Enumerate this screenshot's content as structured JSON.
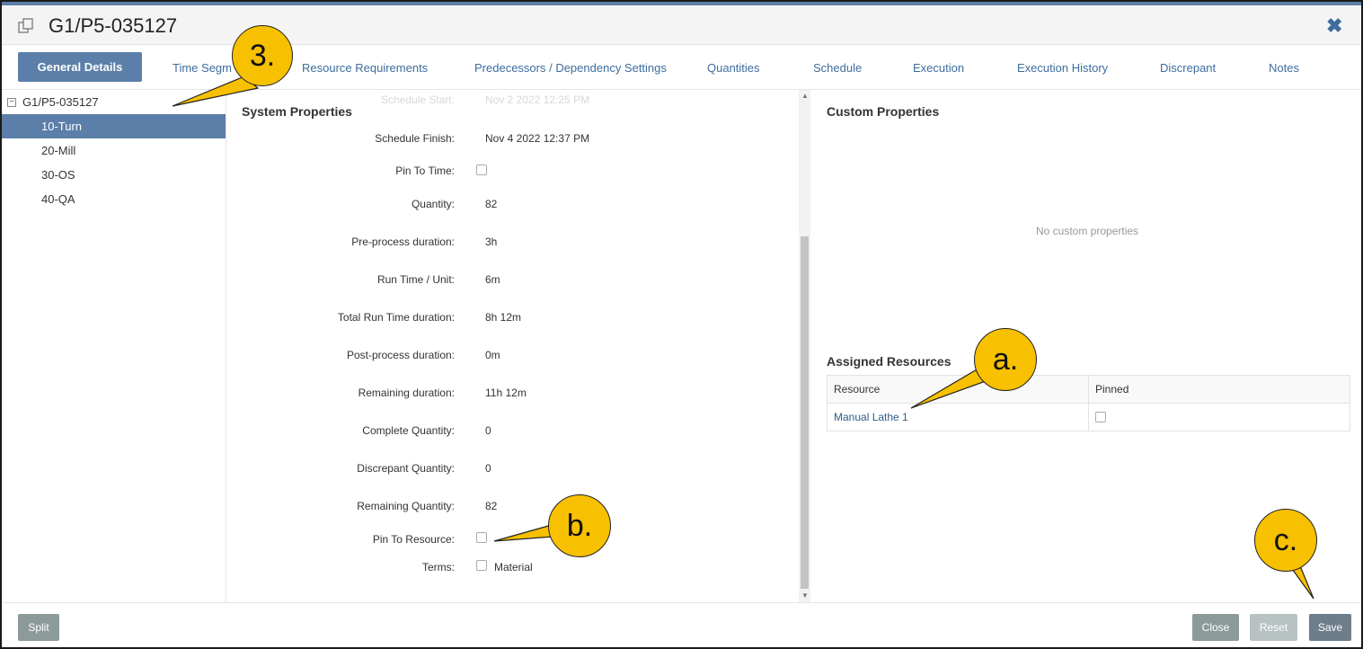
{
  "colors": {
    "accent": "#5b7fa8",
    "selected_row": "#5b7fa8",
    "link": "#3d6d9e",
    "button_gray": "#8c9a9a",
    "button_disabled": "#b9c2c2",
    "button_save": "#6e7d8a",
    "callout": "#f7c000"
  },
  "window": {
    "title": "G1/P5-035127",
    "title_icon": "copy-icon",
    "close_icon": "close-icon"
  },
  "tabs": [
    {
      "label": "General Details",
      "active": true
    },
    {
      "label": "Time Segm"
    },
    {
      "label": "Resource Requirements"
    },
    {
      "label": "Predecessors / Dependency Settings"
    },
    {
      "label": "Quantities"
    },
    {
      "label": "Schedule"
    },
    {
      "label": "Execution"
    },
    {
      "label": "Execution History"
    },
    {
      "label": "Discrepant"
    },
    {
      "label": "Notes"
    }
  ],
  "tree": {
    "root": "G1/P5-035127",
    "items": [
      "10-Turn",
      "20-Mill",
      "30-OS",
      "40-QA"
    ],
    "selected": "10-Turn"
  },
  "system_properties": {
    "title": "System Properties",
    "ghost_label": "Schedule Start:",
    "ghost_value": "Nov 2 2022 12:25 PM",
    "rows": [
      {
        "label": "Schedule Finish:",
        "value": "Nov 4 2022 12:37 PM"
      },
      {
        "label": "Pin To Time:",
        "checkbox": true
      },
      {
        "label": "Quantity:",
        "value": "82"
      },
      {
        "label": "Pre-process duration:",
        "value": "3h"
      },
      {
        "label": "Run Time / Unit:",
        "value": "6m"
      },
      {
        "label": "Total Run Time duration:",
        "value": "8h 12m"
      },
      {
        "label": "Post-process duration:",
        "value": "0m"
      },
      {
        "label": "Remaining duration:",
        "value": "11h 12m"
      },
      {
        "label": "Complete Quantity:",
        "value": "0"
      },
      {
        "label": "Discrepant Quantity:",
        "value": "0"
      },
      {
        "label": "Remaining Quantity:",
        "value": "82"
      },
      {
        "label": "Pin To Resource:",
        "checkbox": true
      },
      {
        "label": "Terms:",
        "checkbox": true,
        "checkbox_label": "Material"
      }
    ]
  },
  "custom_properties": {
    "title": "Custom Properties",
    "empty_text": "No custom properties"
  },
  "assigned_resources": {
    "title": "Assigned Resources",
    "columns": [
      "Resource",
      "Pinned"
    ],
    "rows": [
      {
        "resource": "Manual Lathe 1",
        "pinned": false
      }
    ]
  },
  "footer": {
    "split": "Split",
    "close": "Close",
    "reset": "Reset",
    "save": "Save"
  },
  "callouts": {
    "three": "3.",
    "a": "a.",
    "b": "b.",
    "c": "c."
  }
}
